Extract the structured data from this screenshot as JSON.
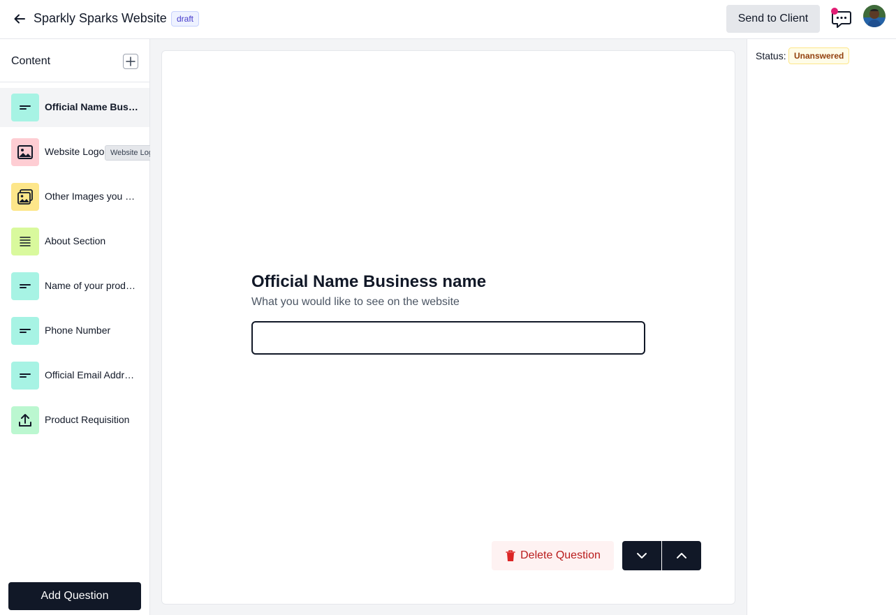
{
  "header": {
    "title": "Sparkly Sparks Website",
    "badge": "draft",
    "send_label": "Send to Client",
    "back_icon": "arrow-left-icon",
    "chat_icon": "chat-bubble-icon",
    "notification_color": "#e11d74"
  },
  "sidebar": {
    "title": "Content",
    "add_icon": "plus-icon",
    "items": [
      {
        "label": "Official Name Business name",
        "icon": "short-text-icon",
        "color": "#a7f3e4",
        "active": true
      },
      {
        "label": "Website Logo",
        "icon": "image-icon",
        "color": "#fecdd3",
        "active": false
      },
      {
        "label": "Other Images you want on the website",
        "icon": "images-icon",
        "color": "#fde68a",
        "active": false
      },
      {
        "label": "About Section",
        "icon": "long-text-icon",
        "color": "#d9f99d",
        "active": false
      },
      {
        "label": "Name of your products",
        "icon": "short-text-icon",
        "color": "#a7f3e4",
        "active": false
      },
      {
        "label": "Phone Number",
        "icon": "short-text-icon",
        "color": "#a7f3e4",
        "active": false
      },
      {
        "label": "Official Email Address",
        "icon": "short-text-icon",
        "color": "#a7f3e4",
        "active": false
      },
      {
        "label": "Product Requisition",
        "icon": "upload-icon",
        "color": "#bbf7d0",
        "active": false
      }
    ],
    "tooltip": "Website Logo",
    "add_question_label": "Add Question"
  },
  "question": {
    "title": "Official Name Business name",
    "subtitle": "What you would like to see on the website",
    "value": "",
    "delete_label": "Delete Question"
  },
  "status": {
    "label": "Status:",
    "value": "Unanswered"
  }
}
